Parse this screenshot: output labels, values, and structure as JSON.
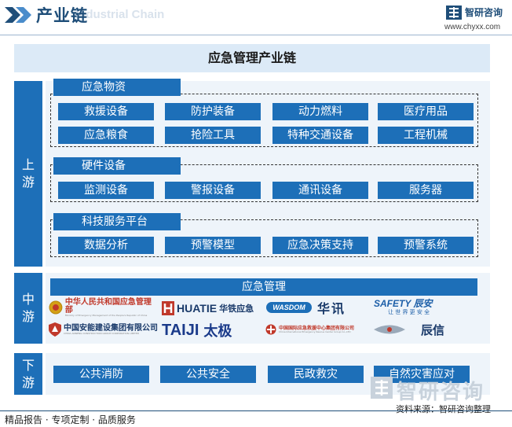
{
  "header": {
    "title": "产业链",
    "watermark": "Industrial Chain",
    "logo_text": "智研咨询",
    "url": "www.chyxx.com"
  },
  "main_title": "应急管理产业链",
  "stages": {
    "up": "上\n游",
    "mid": "中\n游",
    "down": "下\n游"
  },
  "upstream": {
    "groups": [
      {
        "label": "应急物资",
        "items": [
          "救援设备",
          "防护装备",
          "动力燃料",
          "医疗用品",
          "应急粮食",
          "抢险工具",
          "特种交通设备",
          "工程机械"
        ]
      },
      {
        "label": "硬件设备",
        "items": [
          "监测设备",
          "警报设备",
          "通讯设备",
          "服务器"
        ]
      },
      {
        "label": "科技服务平台",
        "items": [
          "数据分析",
          "预警模型",
          "应急决策支持",
          "预警系统"
        ]
      }
    ]
  },
  "midstream": {
    "label": "应急管理",
    "companies": [
      {
        "name": "中华人民共和国应急管理部",
        "sub": "Ministry of Emergency Management of the People's Republic of China"
      },
      {
        "name": "华铁应急",
        "latin": "HUATIE"
      },
      {
        "name": "WASDOM"
      },
      {
        "name": "华讯"
      },
      {
        "name": "SAFETY 辰安",
        "sub": "让 世 界 更 安 全"
      },
      {
        "name": "中国安能建设集团有限公司",
        "sub": "CHINA ANNENG CONSTRUCTION GROUP CORPORATION LIMITED"
      },
      {
        "name": "太极",
        "latin": "TAIJI"
      },
      {
        "name": "中国国际应急救援中心集团有限公司",
        "sub": "China International Emergency Rescue Center Group Co.,LTD"
      },
      {
        "name": "辰信"
      }
    ]
  },
  "downstream": {
    "items": [
      "公共消防",
      "公共安全",
      "民政救灾",
      "自然灾害应对"
    ]
  },
  "source": "资料来源：智研咨询整理",
  "watermark_big": "智研咨询",
  "footer": "精品报告 · 专项定制 · 品质服务",
  "colors": {
    "primary": "#1d6fb8",
    "panel": "#eef4fa",
    "title_bg": "#dceaf7",
    "navy": "#1f4e79"
  }
}
